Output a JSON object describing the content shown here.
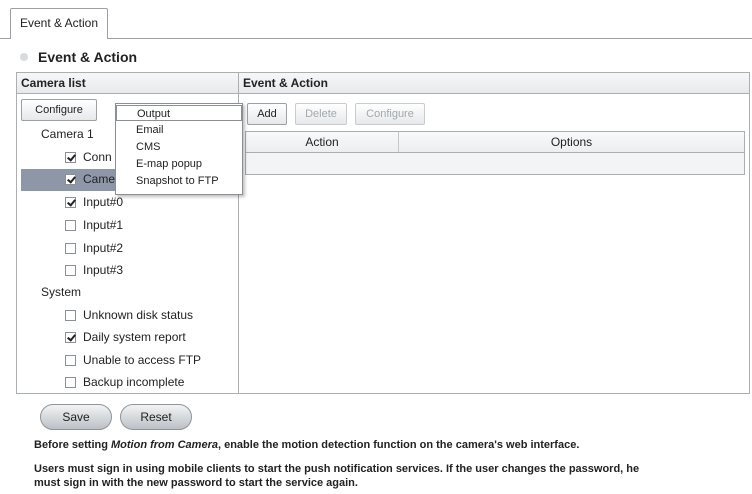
{
  "tabs": [
    {
      "label": "Event & Action"
    }
  ],
  "page_title": "Event & Action",
  "camera_list": {
    "header": "Camera list",
    "configure_button": "Configure",
    "camera_group_label": "Camera 1",
    "camera_items": [
      {
        "label": "Conn",
        "checked": true
      },
      {
        "label": "Came",
        "checked": true,
        "selected": true
      },
      {
        "label": "Input#0",
        "checked": true
      },
      {
        "label": "Input#1",
        "checked": false
      },
      {
        "label": "Input#2",
        "checked": false
      },
      {
        "label": "Input#3",
        "checked": false
      }
    ],
    "system_group_label": "System",
    "system_items": [
      {
        "label": "Unknown disk status",
        "checked": false
      },
      {
        "label": "Daily system report",
        "checked": true
      },
      {
        "label": "Unable to access FTP",
        "checked": false
      },
      {
        "label": "Backup incomplete",
        "checked": false
      }
    ]
  },
  "configure_menu": {
    "items": [
      "Output",
      "Email",
      "CMS",
      "E-map popup",
      "Snapshot to FTP"
    ],
    "active_item": "Output"
  },
  "event_action": {
    "header": "Event & Action",
    "add_button": "Add",
    "delete_button": "Delete",
    "configure_button": "Configure",
    "columns": [
      "Action",
      "Options"
    ]
  },
  "footer": {
    "save_button": "Save",
    "reset_button": "Reset",
    "note1_before": "Before setting ",
    "note1_em": "Motion from Camera",
    "note1_after": ", enable the motion detection function on the camera's web interface.",
    "note2_line1": "Users must sign in using mobile clients to start the push notification services. If the user changes the password, he",
    "note2_line2": "must sign in with the new password to start the service again."
  }
}
